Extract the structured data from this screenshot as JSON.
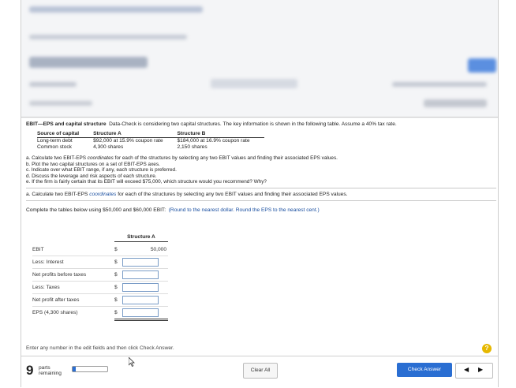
{
  "problem": {
    "title": "EBIT—EPS and capital structure",
    "description": "Data-Check is considering two capital structures. The key information is shown in the following table. Assume a 40% tax rate."
  },
  "capital_table": {
    "headers": [
      "Source of capital",
      "Structure A",
      "Structure B"
    ],
    "rows": [
      [
        "Long-term debt",
        "$92,000 at 15.9% coupon rate",
        "$184,000 at 16.9% coupon rate"
      ],
      [
        "Common stock",
        "4,300 shares",
        "2,150 shares"
      ]
    ]
  },
  "tasks": {
    "a_pre": "a. Calculate two EBIT-EPS ",
    "a_em": "coordinates",
    "a_post": " for each of the structures by selecting any two EBIT values and finding their associated EPS values.",
    "b": "b. Plot the two capital structures on a set of EBIT-EPS axes.",
    "c": "c. Indicate over what EBIT range, if any, each structure is preferred.",
    "d": "d. Discuss the leverage and risk aspects of each structure.",
    "e": "e. If the firm is fairly certain that its EBIT will exceed $75,000, which structure would you recommend? Why?"
  },
  "current_task": {
    "pre": "a. Calculate two EBIT-EPS ",
    "em": "coordinates",
    "post": " for each of the structures by selecting any two EBIT values and finding their associated EPS values."
  },
  "complete": {
    "text": "Complete the tables below using $50,000 and $60,000 EBIT:",
    "hint": "(Round to the nearest dollar. Round the EPS to the nearest cent.)"
  },
  "calc_table": {
    "header": "Structure A",
    "currency": "$",
    "rows": [
      {
        "label": "EBIT",
        "value": "50,000"
      },
      {
        "label": "Less: Interest",
        "value": ""
      },
      {
        "label": "Net profits before taxes",
        "value": ""
      },
      {
        "label": "Less: Taxes",
        "value": ""
      },
      {
        "label": "Net profit after taxes",
        "value": ""
      },
      {
        "label": "EPS (4,300 shares)",
        "value": ""
      }
    ]
  },
  "instruction": "Enter any number in the edit fields and then click Check Answer.",
  "footer": {
    "parts_count": "9",
    "parts_label_1": "parts",
    "parts_label_2": "remaining",
    "progress": 0.1,
    "clear_label": "Clear All",
    "check_label": "Check Answer",
    "prev_glyph": "◀",
    "next_glyph": "▶",
    "help_glyph": "?"
  },
  "colors": {
    "accent": "#2a6ed2",
    "help": "#e6b800"
  }
}
